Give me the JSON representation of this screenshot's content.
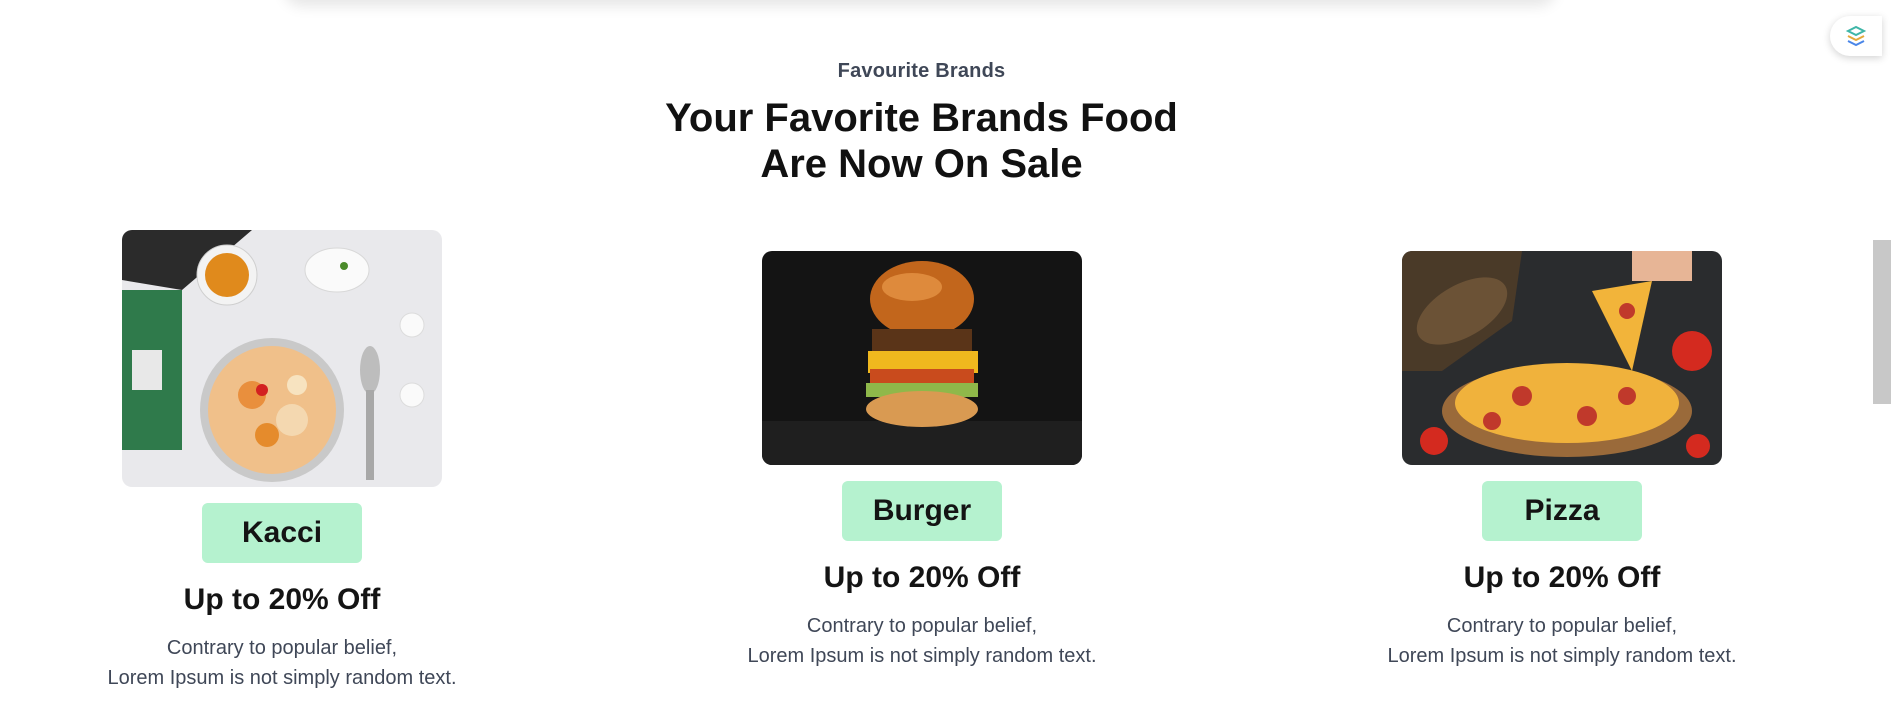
{
  "section": {
    "eyebrow": "Favourite Brands",
    "title_line1": "Your Favorite Brands Food",
    "title_line2": "Are Now On Sale"
  },
  "cards": [
    {
      "name": "Kacci",
      "image_alt": "Kacci biryani dish",
      "offer": "Up to 20% Off",
      "desc_line1": "Contrary to popular belief,",
      "desc_line2": "Lorem Ipsum is not simply random text."
    },
    {
      "name": "Burger",
      "image_alt": "Cheese burger",
      "offer": "Up to 20% Off",
      "desc_line1": "Contrary to popular belief,",
      "desc_line2": "Lorem Ipsum is not simply random text."
    },
    {
      "name": "Pizza",
      "image_alt": "Pepperoni pizza",
      "offer": "Up to 20% Off",
      "desc_line1": "Contrary to popular belief,",
      "desc_line2": "Lorem Ipsum is not simply random text."
    }
  ],
  "colors": {
    "tag_bg": "#b5f2cf",
    "text_dark": "#141414",
    "text_muted": "#3f4757"
  },
  "icons": {
    "floating": "layers-logo-icon"
  }
}
